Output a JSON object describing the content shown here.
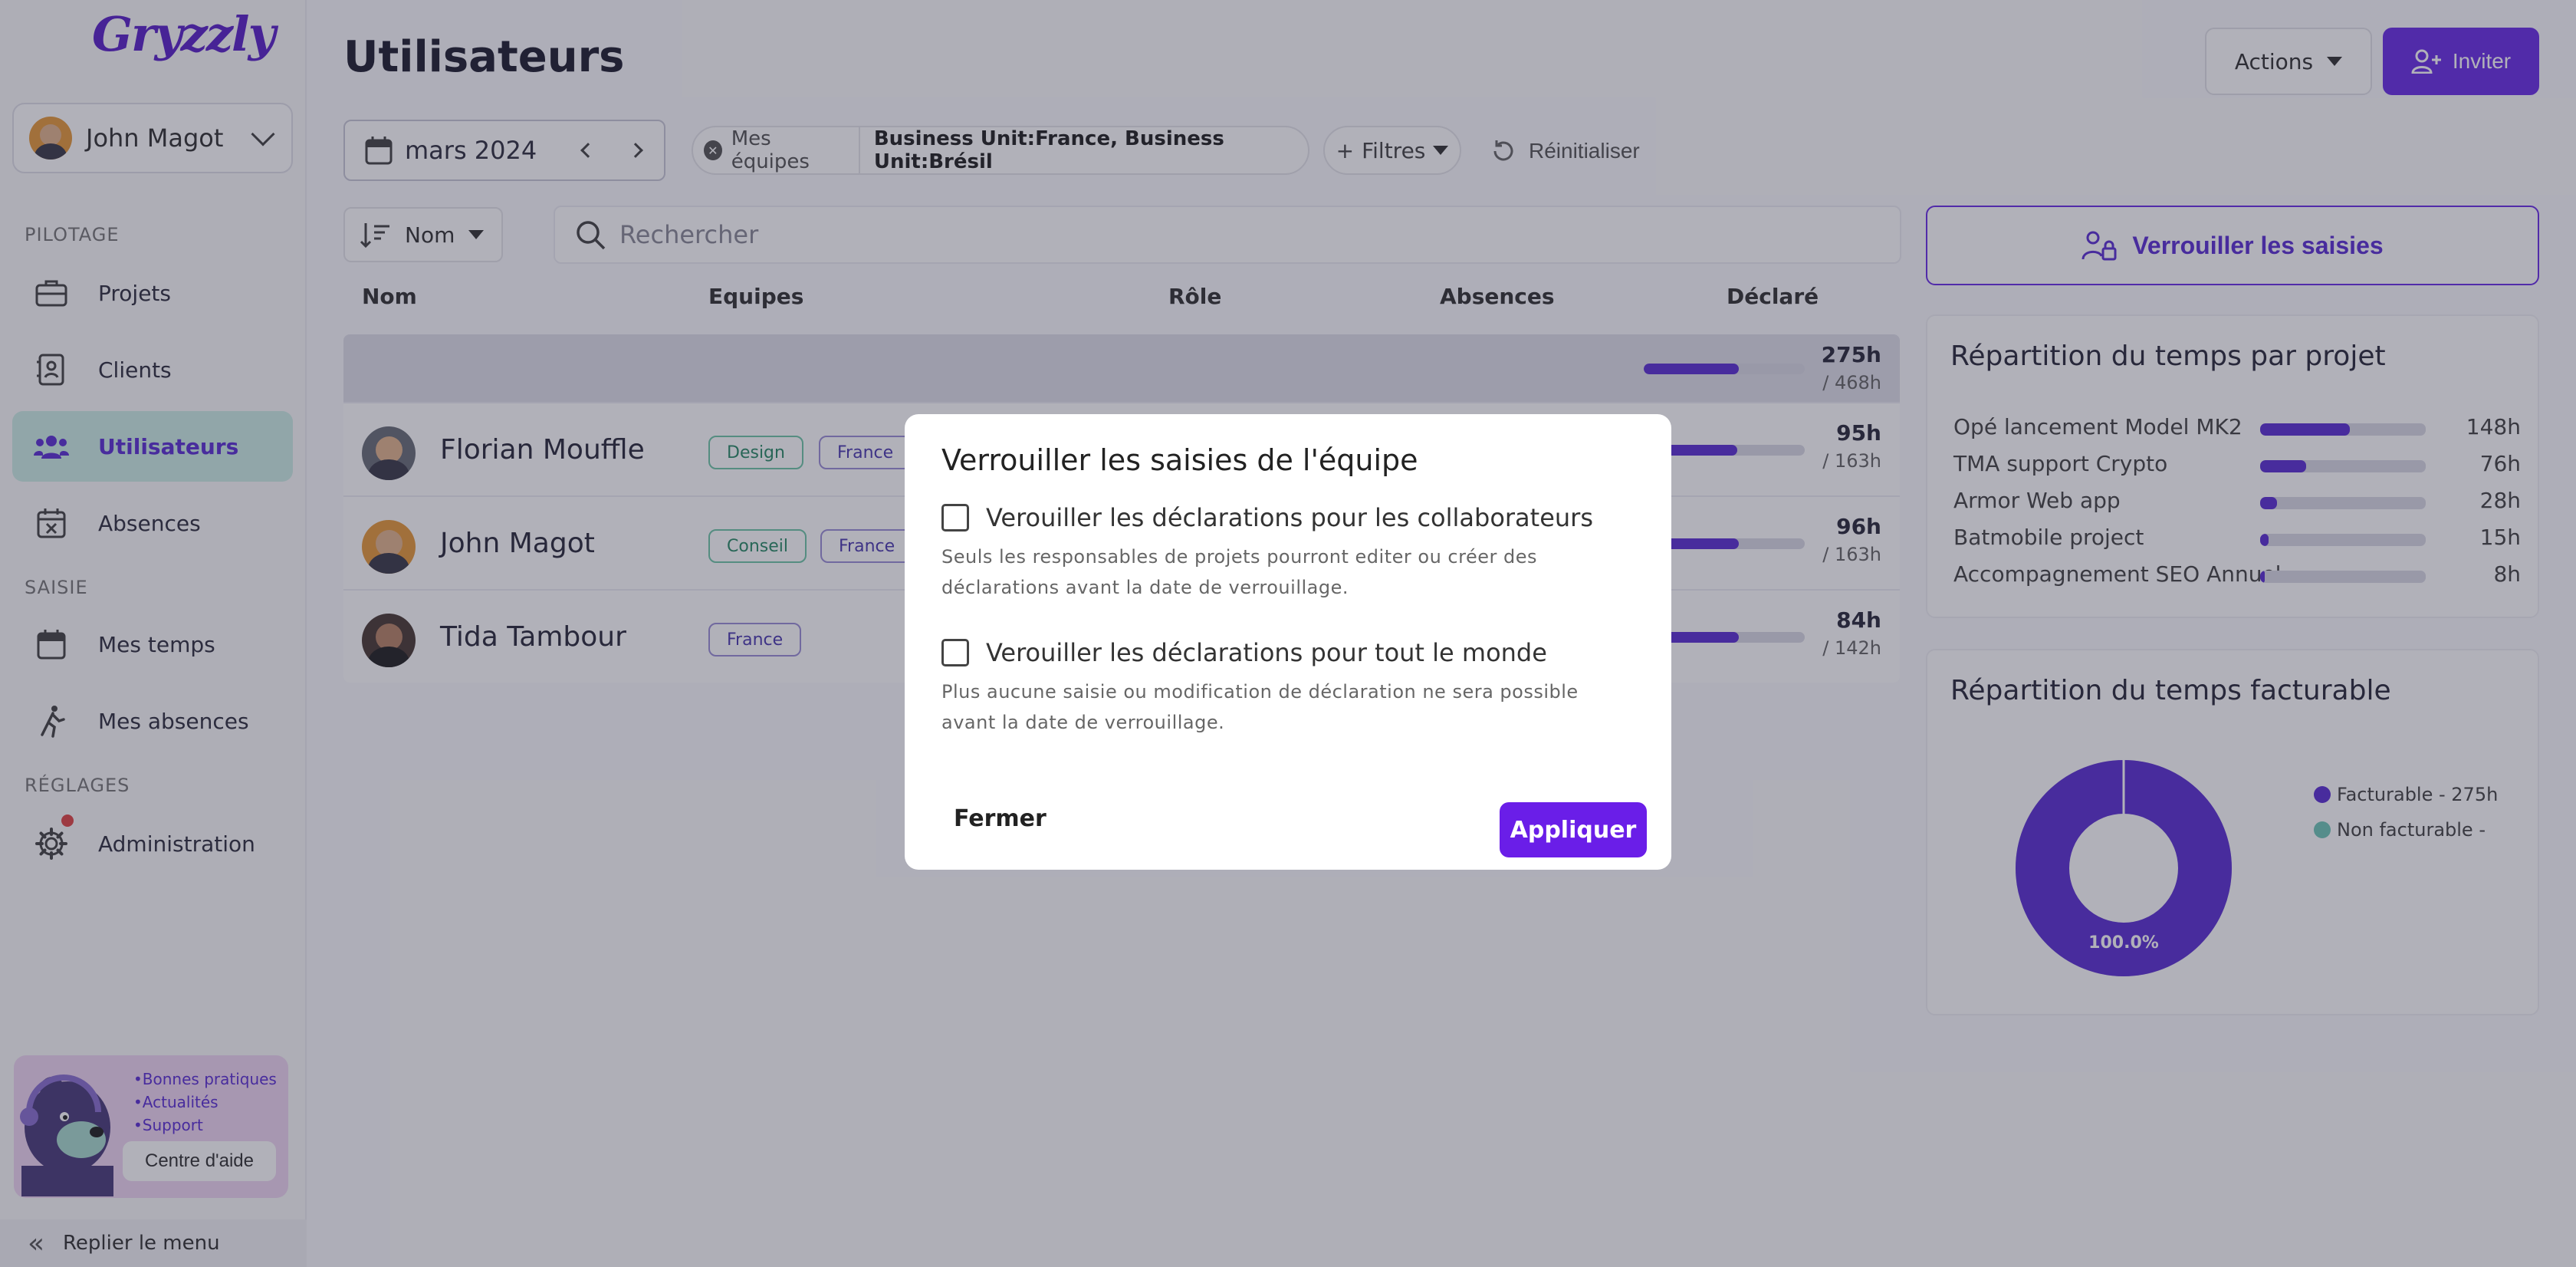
{
  "app": {
    "logo_text": "Gryzzly"
  },
  "user": {
    "name": "John Magot"
  },
  "sidebar": {
    "sections": [
      "PILOTAGE",
      "SAISIE",
      "RÉGLAGES"
    ],
    "items": [
      {
        "label": "Projets",
        "icon": "briefcase-icon"
      },
      {
        "label": "Clients",
        "icon": "address-book-icon"
      },
      {
        "label": "Utilisateurs",
        "icon": "users-icon",
        "active": true
      },
      {
        "label": "Absences",
        "icon": "calendar-x-icon"
      },
      {
        "label": "Mes temps",
        "icon": "calendar-icon"
      },
      {
        "label": "Mes absences",
        "icon": "walking-icon"
      },
      {
        "label": "Administration",
        "icon": "gear-icon",
        "notification": true
      }
    ],
    "help": {
      "links": [
        "•Bonnes pratiques",
        "•Actualités",
        "•Support"
      ],
      "button": "Centre d'aide"
    },
    "collapse_label": "Replier le menu"
  },
  "header": {
    "title": "Utilisateurs",
    "actions_label": "Actions",
    "invite_label": "Inviter"
  },
  "toolbar": {
    "date": "mars 2024",
    "filter_label": "Mes équipes",
    "filter_value": "Business Unit:France, Business Unit:Brésil",
    "filters_label": "Filtres",
    "reset_label": "Réinitialiser",
    "sort_label": "Nom",
    "search_placeholder": "Rechercher"
  },
  "table": {
    "columns": [
      "Nom",
      "Equipes",
      "Rôle",
      "Absences",
      "Déclaré"
    ],
    "summary": {
      "declared": "275h",
      "total": "/ 468h",
      "progress": 0.59
    },
    "rows": [
      {
        "name": "Florian Mouffle",
        "tags": [
          "Design",
          "France"
        ],
        "declared": "95h",
        "total": "/ 163h",
        "progress": 0.58
      },
      {
        "name": "John Magot",
        "tags": [
          "Conseil",
          "France"
        ],
        "declared": "96h",
        "total": "/ 163h",
        "progress": 0.59
      },
      {
        "name": "Tida Tambour",
        "tags": [
          "France"
        ],
        "declared": "84h",
        "total": "/ 142h",
        "progress": 0.59
      }
    ]
  },
  "right_panel": {
    "lock_button": "Verrouiller les saisies",
    "projects_title": "Répartition du temps par projet",
    "projects": [
      {
        "name": "Opé lancement Model MK2",
        "value": "148h",
        "progress": 0.54
      },
      {
        "name": "TMA support Crypto",
        "value": "76h",
        "progress": 0.28
      },
      {
        "name": "Armor Web app",
        "value": "28h",
        "progress": 0.1
      },
      {
        "name": "Batmobile project",
        "value": "15h",
        "progress": 0.05
      },
      {
        "name": "Accompagnement SEO Annuel",
        "value": "8h",
        "progress": 0.03
      }
    ],
    "billable_title": "Répartition du temps facturable",
    "billable_legend": [
      "Facturable - 275h",
      "Non facturable -"
    ],
    "billable_percent": "100.0%",
    "billable_fraction": 1.0,
    "colors": {
      "billable": "#5b2fd4",
      "non_billable": "#6fc7b8"
    }
  },
  "modal": {
    "title": "Verrouiller les saisies de l'équipe",
    "option1_label": "Verouiller les déclarations pour les collaborateurs",
    "option1_desc": "Seuls les responsables de projets pourront editer ou créer des déclarations avant la date de verrouillage.",
    "option2_label": "Verouiller les déclarations pour tout le monde",
    "option2_desc": "Plus aucune saisie ou modification de déclaration ne sera possible avant la date de verrouillage.",
    "close_label": "Fermer",
    "apply_label": "Appliquer"
  }
}
